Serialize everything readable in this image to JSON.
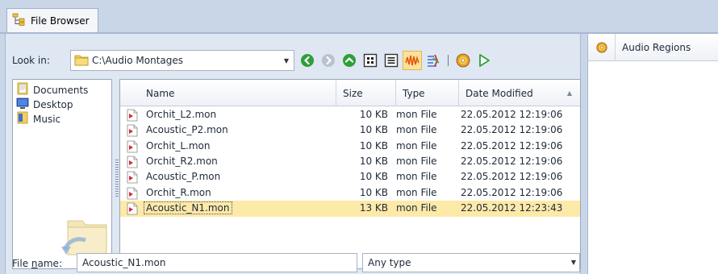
{
  "tab": {
    "title": "File Browser"
  },
  "look_in": {
    "label": "Look in:",
    "path": "C:\\Audio Montages"
  },
  "toolbar": {
    "icons": [
      "back-icon",
      "forward-icon",
      "up-icon",
      "icons-view-icon",
      "details-view-icon",
      "waveform-icon",
      "colors-icon",
      "cd-icon",
      "play-icon"
    ]
  },
  "places": [
    {
      "label": "Documents",
      "icon": "documents-folder-icon"
    },
    {
      "label": "Desktop",
      "icon": "desktop-icon"
    },
    {
      "label": "Music",
      "icon": "music-folder-icon"
    }
  ],
  "file_list": {
    "columns": [
      "Name",
      "Size",
      "Type",
      "Date Modified"
    ],
    "rows": [
      {
        "name": "Orchit_L2.mon",
        "size": "10 KB",
        "type": "mon File",
        "date": "22.05.2012 12:19:06"
      },
      {
        "name": "Acoustic_P2.mon",
        "size": "10 KB",
        "type": "mon File",
        "date": "22.05.2012 12:19:06"
      },
      {
        "name": "Orchit_L.mon",
        "size": "10 KB",
        "type": "mon File",
        "date": "22.05.2012 12:19:06"
      },
      {
        "name": "Orchit_R2.mon",
        "size": "10 KB",
        "type": "mon File",
        "date": "22.05.2012 12:19:06"
      },
      {
        "name": "Acoustic_P.mon",
        "size": "10 KB",
        "type": "mon File",
        "date": "22.05.2012 12:19:06"
      },
      {
        "name": "Orchit_R.mon",
        "size": "10 KB",
        "type": "mon File",
        "date": "22.05.2012 12:19:06"
      },
      {
        "name": "Acoustic_N1.mon",
        "size": "13 KB",
        "type": "mon File",
        "date": "22.05.2012 12:23:43",
        "selected": true
      }
    ]
  },
  "filename": {
    "label_prefix": "File ",
    "label_underlined": "n",
    "label_suffix": "ame:",
    "value": "Acoustic_N1.mon"
  },
  "filetype": {
    "value": "Any type"
  },
  "right_panel": {
    "title": "Audio Regions"
  },
  "colors": {
    "background": "#c9d6e8",
    "panel": "#dfe7f2",
    "selection": "#fde9a8"
  }
}
